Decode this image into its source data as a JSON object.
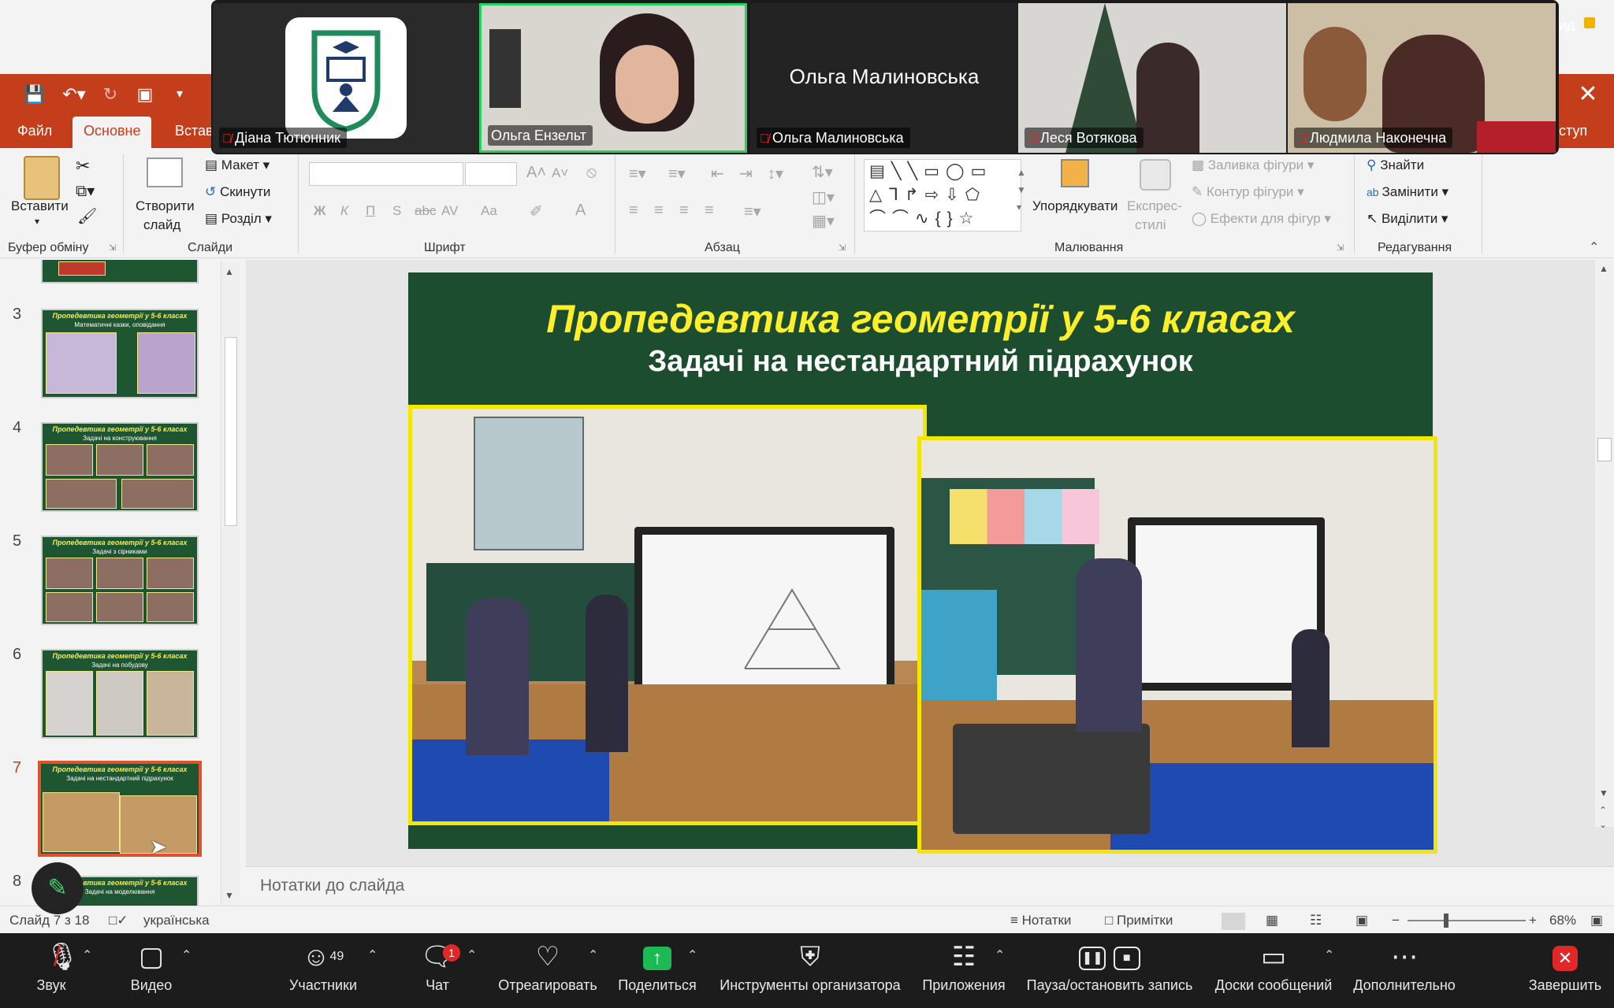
{
  "gallery": {
    "participants": [
      {
        "name": "Діана Тютюнник",
        "muted": true,
        "kind": "logo"
      },
      {
        "name": "Ольга Ензельт",
        "muted": false,
        "kind": "video",
        "active": true
      },
      {
        "name": "Ольга Малиновська",
        "muted": true,
        "kind": "name",
        "big_name": "Ольга Малиновська"
      },
      {
        "name": "Леся Вотякова",
        "muted": true,
        "kind": "video"
      },
      {
        "name": "Людмила Наконечна",
        "muted": true,
        "kind": "video"
      }
    ],
    "corner_text": "ид"
  },
  "ppt": {
    "tabs": [
      "Файл",
      "Основне",
      "Встав",
      "ступ"
    ],
    "active_tab": "Основне",
    "ribbon": {
      "clipboard": {
        "paste": "Вставити",
        "label": "Буфер обміну"
      },
      "slides": {
        "create": "Створити",
        "create2": "слайд",
        "layout": "Макет",
        "reset": "Скинути",
        "section": "Розділ",
        "label": "Слайди"
      },
      "font": {
        "label": "Шрифт",
        "bold": "Ж",
        "italic": "К",
        "underline": "П",
        "shadow": "S",
        "strike": "abc",
        "spacing": "AV",
        "case": "Aa"
      },
      "paragraph": {
        "label": "Абзац"
      },
      "drawing": {
        "arrange": "Упорядкувати",
        "styles": "Експрес-",
        "styles2": "стилі",
        "fill": "Заливка фігури",
        "outline": "Контур фігури",
        "effects": "Ефекти для фігур",
        "label": "Малювання"
      },
      "editing": {
        "find": "Знайти",
        "replace": "Замінити",
        "select": "Виділити",
        "label": "Редагування"
      }
    },
    "thumbnails": [
      {
        "num": "3",
        "title": "Пропедевтика геометрії у 5-6 класах",
        "sub": "Математичні казки, оповідання"
      },
      {
        "num": "4",
        "title": "Пропедевтика геометрії у 5-6 класах",
        "sub": "Задачі на конструювання"
      },
      {
        "num": "5",
        "title": "Пропедевтика геометрії у 5-6 класах",
        "sub": "Задачі з сірниками"
      },
      {
        "num": "6",
        "title": "Пропедевтика геометрії у 5-6 класах",
        "sub": "Задачі на побудову"
      },
      {
        "num": "7",
        "title": "Пропедевтика геометрії у 5-6 класах",
        "sub": "Задачі на нестандартний підрахунок"
      },
      {
        "num": "8",
        "title": "Пропедевтика геометрії у 5-6 класах",
        "sub": "Задачі на моделювання"
      }
    ],
    "selected_slide": "7",
    "slide": {
      "title": "Пропедевтика геометрії у 5-6 класах",
      "subtitle": "Задачі на нестандартний підрахунок"
    },
    "notes_placeholder": "Нотатки до слайда",
    "status": {
      "slide_info": "Слайд 7 з 18",
      "language": "українська",
      "notes": "Нотатки",
      "comments": "Примітки",
      "zoom": "68%"
    }
  },
  "zoom_toolbar": {
    "audio": "Звук",
    "video": "Видео",
    "participants": "Участники",
    "participants_count": "49",
    "chat": "Чат",
    "chat_badge": "1",
    "react": "Отреагировать",
    "share": "Поделиться",
    "host_tools": "Инструменты организатора",
    "apps": "Приложения",
    "record": "Пауза/остановить запись",
    "whiteboards": "Доски сообщений",
    "more": "Дополнительно",
    "end": "Завершить"
  }
}
